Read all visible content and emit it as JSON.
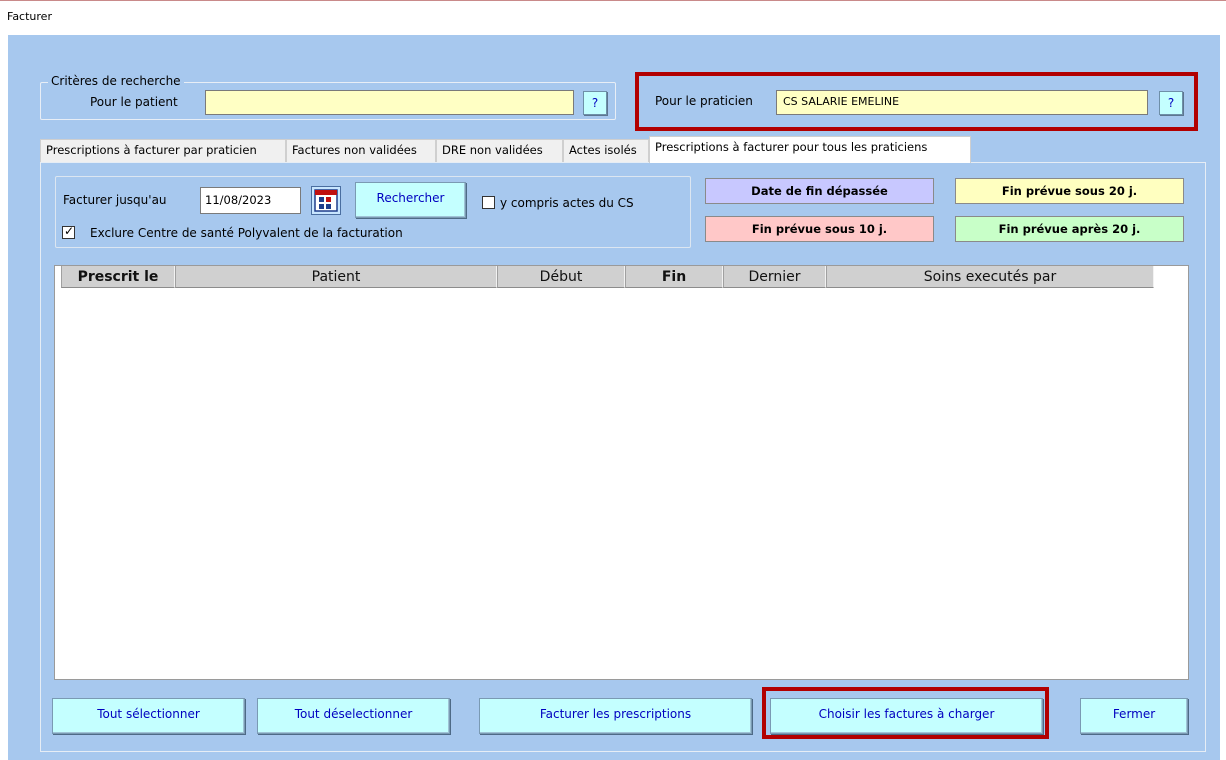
{
  "window": {
    "title": "Facturer"
  },
  "search_criteria": {
    "group_label": "Critères de recherche",
    "patient_label": "Pour le patient",
    "patient_value": "",
    "patient_lookup_label": "?",
    "practitioner_label": "Pour le praticien",
    "practitioner_value": "CS SALARIE EMELINE",
    "practitioner_lookup_label": "?"
  },
  "tabs": [
    {
      "label": "Prescriptions à facturer par praticien",
      "active": false
    },
    {
      "label": "Factures non validées",
      "active": false
    },
    {
      "label": "DRE non validées",
      "active": false
    },
    {
      "label": "Actes isolés",
      "active": false
    },
    {
      "label": "Prescriptions à facturer pour tous les praticiens",
      "active": true
    }
  ],
  "filters": {
    "bill_until_label": "Facturer jusqu'au",
    "bill_until_value": "11/08/2023",
    "search_button": "Rechercher",
    "include_cs_label": "y compris actes du CS",
    "include_cs_checked": false,
    "exclude_center_label": "Exclure Centre de santé Polyvalent de la facturation",
    "exclude_center_checked": true
  },
  "legend": [
    {
      "label": "Date de fin dépassée",
      "color": "#c8c8ff"
    },
    {
      "label": "Fin prévue sous 20 j.",
      "color": "#ffffc0"
    },
    {
      "label": "Fin prévue sous 10 j.",
      "color": "#ffc8c8"
    },
    {
      "label": "Fin prévue après 20 j.",
      "color": "#c8ffc8"
    }
  ],
  "grid": {
    "columns": [
      "Prescrit le",
      "Patient",
      "Début",
      "Fin",
      "Dernier",
      "Soins executés par"
    ],
    "rows": []
  },
  "buttons": {
    "select_all": "Tout sélectionner",
    "deselect_all": "Tout déselectionner",
    "bill_prescriptions": "Facturer les prescriptions",
    "choose_invoices": "Choisir les factures à charger",
    "close": "Fermer"
  },
  "colors": {
    "background": "#a7c8ee",
    "button": "#c4ffff",
    "input_yellow": "#ffffc4",
    "highlight_red": "#b20000"
  }
}
